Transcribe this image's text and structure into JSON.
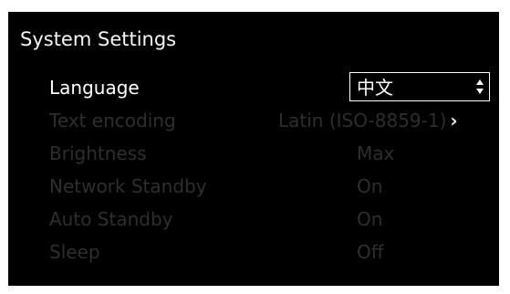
{
  "title": "System Settings",
  "settings": [
    {
      "label": "Language",
      "value": "中文",
      "enabled": true
    },
    {
      "label": "Text encoding",
      "value": "Latin (ISO-8859-1)",
      "enabled": false
    },
    {
      "label": "Brightness",
      "value": "Max",
      "enabled": false
    },
    {
      "label": "Network Standby",
      "value": "On",
      "enabled": false
    },
    {
      "label": "Auto Standby",
      "value": "On",
      "enabled": false
    },
    {
      "label": "Sleep",
      "value": "Off",
      "enabled": false
    }
  ],
  "icons": {
    "language_select": "up-down-stepper-icon",
    "text_encoding": "chevron-right-icon"
  },
  "colors": {
    "background": "#000000",
    "active_text": "#ffffff",
    "disabled_text": "#2e2e2e",
    "page": "#ffffff"
  }
}
